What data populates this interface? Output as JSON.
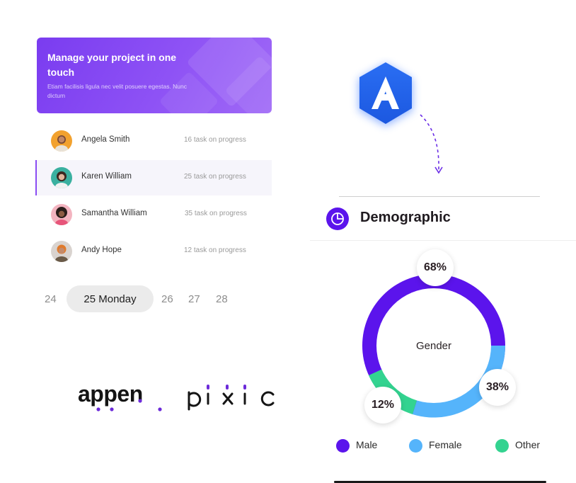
{
  "banner": {
    "title": "Manage your project in one touch",
    "subtitle": "Etiam facilisis ligula nec velit posuere egestas. Nunc dictum"
  },
  "users": [
    {
      "name": "Angela Smith",
      "task": "16 task on progress",
      "active": false
    },
    {
      "name": "Karen William",
      "task": "25 task on progress",
      "active": true
    },
    {
      "name": "Samantha William",
      "task": "35 task on progress",
      "active": false
    },
    {
      "name": "Andy Hope",
      "task": "12 task on progress",
      "active": false
    }
  ],
  "days": {
    "before": [
      "24"
    ],
    "selected": "25 Monday",
    "after": [
      "26",
      "27",
      "28"
    ]
  },
  "logos": {
    "appen": "appen",
    "pixic": "pixic"
  },
  "badge": {
    "letter": "A"
  },
  "demographic": {
    "title": "Demographic",
    "center_label": "Gender",
    "icon": "pie-chart-icon"
  },
  "colors": {
    "accent": "#5b14ec",
    "male": "#5b14ec",
    "female": "#55b4fb",
    "other": "#33d390"
  },
  "chart_data": {
    "type": "pie",
    "title": "",
    "series": [
      {
        "name": "Male",
        "value": 68,
        "label": "68%"
      },
      {
        "name": "Female",
        "value": 38,
        "label": "38%"
      },
      {
        "name": "Other",
        "value": 12,
        "label": "12%"
      }
    ],
    "center_label": "Gender",
    "legend_position": "bottom"
  }
}
